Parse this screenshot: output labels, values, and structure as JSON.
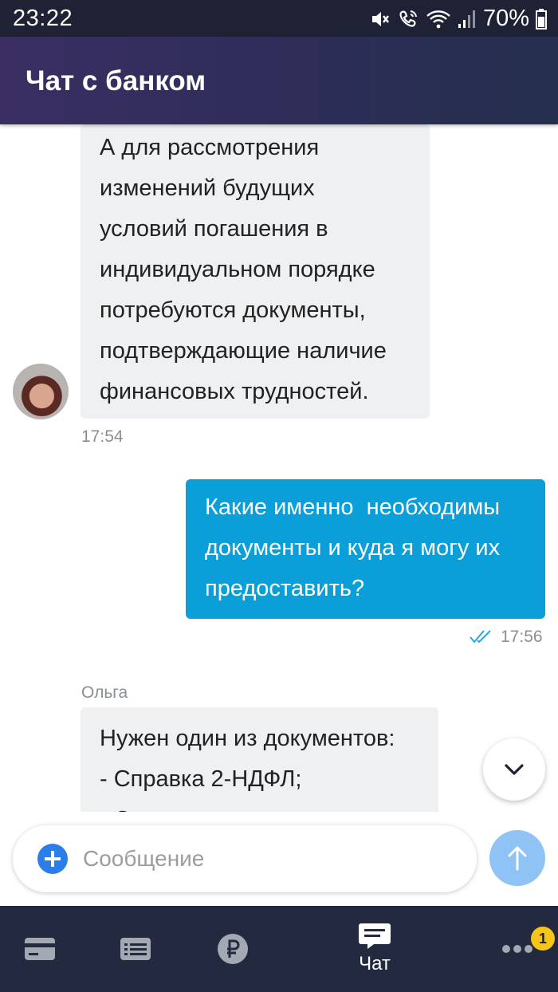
{
  "status_bar": {
    "time": "23:22",
    "battery": "70%"
  },
  "header": {
    "title": "Чат с банком"
  },
  "messages": [
    {
      "direction": "incoming",
      "lines": [
        "А для рассмотрения",
        "изменений будущих",
        "условий погашения в",
        "индивидуальном порядке",
        "потребуются документы,",
        "подтверждающие наличие",
        "финансовых трудностей."
      ],
      "time": "17:54"
    },
    {
      "direction": "outgoing",
      "lines": [
        "Какие именно  необходимы",
        "документы и куда я могу их",
        "предоставить?"
      ],
      "time": "17:56",
      "read_icon": "double-check-icon"
    },
    {
      "direction": "incoming",
      "sender": "Ольга",
      "lines": [
        "Нужен один из документов:",
        "- Справка 2-НДФЛ;",
        "- С..."
      ]
    }
  ],
  "composer": {
    "placeholder": "Сообщение"
  },
  "bottom_nav": [
    {
      "icon": "card-icon",
      "label": ""
    },
    {
      "icon": "list-icon",
      "label": ""
    },
    {
      "icon": "ruble-icon",
      "label": ""
    },
    {
      "icon": "chat-icon",
      "label": "Чат"
    },
    {
      "icon": "more-icon",
      "label": "",
      "badge": "1"
    }
  ],
  "colors": {
    "accent": "#0a9fd8",
    "header": "#2d2d58",
    "nav": "#232a3f",
    "badge": "#f5c518"
  }
}
